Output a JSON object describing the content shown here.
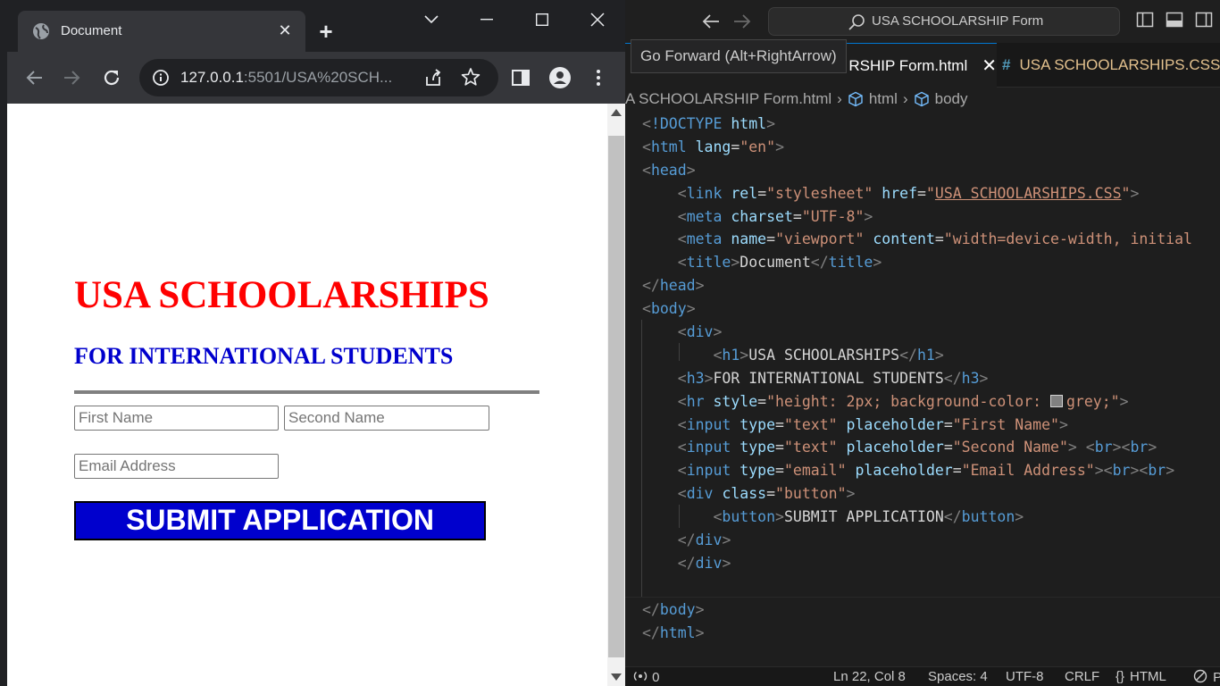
{
  "browser": {
    "tab": {
      "title": "Document",
      "close": "✕"
    },
    "new_tab": "+",
    "url_host": "127.0.0.1",
    "url_rest": ":5501/USA%20SCH...",
    "window_controls": {
      "list": "⌄",
      "minimize": "—",
      "maximize": "☐",
      "close": "✕"
    }
  },
  "page": {
    "heading": "USA SCHOOLARSHIPS",
    "subheading": "FOR INTERNATIONAL STUDENTS",
    "first_name_placeholder": "First Name",
    "second_name_placeholder": "Second Name",
    "email_placeholder": "Email Address",
    "submit_label": "SUBMIT APPLICATION",
    "colors": {
      "heading": "#ff0000",
      "subheading": "#0000cd",
      "button": "#0000cd",
      "rule": "#808080"
    }
  },
  "vscode": {
    "search_text": "USA SCHOOLARSHIP Form",
    "tooltip": "Go Forward (Alt+RightArrow)",
    "tabs": [
      {
        "label": "RSHIP Form.html",
        "close": "✕"
      },
      {
        "label": "USA SCHOOLARSHIPS.CSS",
        "icon": "#"
      }
    ],
    "breadcrumb": [
      "A SCHOOLARSHIP Form.html",
      "html",
      "body"
    ],
    "status": {
      "problems": "0",
      "position": "Ln 22, Col 8",
      "spaces": "Spaces: 4",
      "encoding": "UTF-8",
      "eol": "CRLF",
      "language": "HTML",
      "extra": "P"
    },
    "code": [
      {
        "indent": 0,
        "tokens": [
          [
            "punct",
            "<"
          ],
          [
            "tag",
            "!DOCTYPE"
          ],
          [
            "text",
            " "
          ],
          [
            "attr",
            "html"
          ],
          [
            "punct",
            ">"
          ]
        ]
      },
      {
        "indent": 0,
        "tokens": [
          [
            "punct",
            "<"
          ],
          [
            "tag",
            "html"
          ],
          [
            "text",
            " "
          ],
          [
            "attr",
            "lang"
          ],
          [
            "text",
            "="
          ],
          [
            "str",
            "\"en\""
          ],
          [
            "punct",
            ">"
          ]
        ]
      },
      {
        "indent": 0,
        "tokens": [
          [
            "punct",
            "<"
          ],
          [
            "tag",
            "head"
          ],
          [
            "punct",
            ">"
          ]
        ]
      },
      {
        "indent": 1,
        "tokens": [
          [
            "punct",
            "<"
          ],
          [
            "tag",
            "link"
          ],
          [
            "text",
            " "
          ],
          [
            "attr",
            "rel"
          ],
          [
            "text",
            "="
          ],
          [
            "str",
            "\"stylesheet\""
          ],
          [
            "text",
            " "
          ],
          [
            "attr",
            "href"
          ],
          [
            "text",
            "="
          ],
          [
            "str",
            "\""
          ],
          [
            "link",
            "USA SCHOOLARSHIPS.CSS"
          ],
          [
            "str",
            "\""
          ],
          [
            "punct",
            ">"
          ]
        ]
      },
      {
        "indent": 1,
        "tokens": [
          [
            "punct",
            "<"
          ],
          [
            "tag",
            "meta"
          ],
          [
            "text",
            " "
          ],
          [
            "attr",
            "charset"
          ],
          [
            "text",
            "="
          ],
          [
            "str",
            "\"UTF-8\""
          ],
          [
            "punct",
            ">"
          ]
        ]
      },
      {
        "indent": 1,
        "tokens": [
          [
            "punct",
            "<"
          ],
          [
            "tag",
            "meta"
          ],
          [
            "text",
            " "
          ],
          [
            "attr",
            "name"
          ],
          [
            "text",
            "="
          ],
          [
            "str",
            "\"viewport\""
          ],
          [
            "text",
            " "
          ],
          [
            "attr",
            "content"
          ],
          [
            "text",
            "="
          ],
          [
            "str",
            "\"width=device-width, initial"
          ]
        ]
      },
      {
        "indent": 1,
        "tokens": [
          [
            "punct",
            "<"
          ],
          [
            "tag",
            "title"
          ],
          [
            "punct",
            ">"
          ],
          [
            "text",
            "Document"
          ],
          [
            "punct",
            "</"
          ],
          [
            "tag",
            "title"
          ],
          [
            "punct",
            ">"
          ]
        ]
      },
      {
        "indent": 0,
        "tokens": [
          [
            "punct",
            "</"
          ],
          [
            "tag",
            "head"
          ],
          [
            "punct",
            ">"
          ]
        ]
      },
      {
        "indent": 0,
        "tokens": [
          [
            "punct",
            "<"
          ],
          [
            "tag",
            "body"
          ],
          [
            "punct",
            ">"
          ]
        ]
      },
      {
        "indent": 1,
        "tokens": [
          [
            "punct",
            "<"
          ],
          [
            "tag",
            "div"
          ],
          [
            "punct",
            ">"
          ]
        ]
      },
      {
        "indent": 2,
        "tokens": [
          [
            "punct",
            "<"
          ],
          [
            "tag",
            "h1"
          ],
          [
            "punct",
            ">"
          ],
          [
            "text",
            "USA SCHOOLARSHIPS"
          ],
          [
            "punct",
            "</"
          ],
          [
            "tag",
            "h1"
          ],
          [
            "punct",
            ">"
          ]
        ]
      },
      {
        "indent": 1,
        "tokens": [
          [
            "punct",
            "<"
          ],
          [
            "tag",
            "h3"
          ],
          [
            "punct",
            ">"
          ],
          [
            "text",
            "FOR INTERNATIONAL STUDENTS"
          ],
          [
            "punct",
            "</"
          ],
          [
            "tag",
            "h3"
          ],
          [
            "punct",
            ">"
          ]
        ]
      },
      {
        "indent": 1,
        "tokens": [
          [
            "punct",
            "<"
          ],
          [
            "tag",
            "hr"
          ],
          [
            "text",
            " "
          ],
          [
            "attr",
            "style"
          ],
          [
            "text",
            "="
          ],
          [
            "str",
            "\"height: 2px; background-color: "
          ],
          [
            "swatch",
            ""
          ],
          [
            "str",
            "grey;\""
          ],
          [
            "punct",
            ">"
          ]
        ]
      },
      {
        "indent": 1,
        "tokens": [
          [
            "punct",
            "<"
          ],
          [
            "tag",
            "input"
          ],
          [
            "text",
            " "
          ],
          [
            "attr",
            "type"
          ],
          [
            "text",
            "="
          ],
          [
            "str",
            "\"text\""
          ],
          [
            "text",
            " "
          ],
          [
            "attr",
            "placeholder"
          ],
          [
            "text",
            "="
          ],
          [
            "str",
            "\"First Name\""
          ],
          [
            "punct",
            ">"
          ]
        ]
      },
      {
        "indent": 1,
        "tokens": [
          [
            "punct",
            "<"
          ],
          [
            "tag",
            "input"
          ],
          [
            "text",
            " "
          ],
          [
            "attr",
            "type"
          ],
          [
            "text",
            "="
          ],
          [
            "str",
            "\"text\""
          ],
          [
            "text",
            " "
          ],
          [
            "attr",
            "placeholder"
          ],
          [
            "text",
            "="
          ],
          [
            "str",
            "\"Second Name\""
          ],
          [
            "punct",
            ">"
          ],
          [
            "text",
            " "
          ],
          [
            "punct",
            "<"
          ],
          [
            "tag",
            "br"
          ],
          [
            "punct",
            "><"
          ],
          [
            "tag",
            "br"
          ],
          [
            "punct",
            ">"
          ]
        ]
      },
      {
        "indent": 1,
        "tokens": [
          [
            "punct",
            "<"
          ],
          [
            "tag",
            "input"
          ],
          [
            "text",
            " "
          ],
          [
            "attr",
            "type"
          ],
          [
            "text",
            "="
          ],
          [
            "str",
            "\"email\""
          ],
          [
            "text",
            " "
          ],
          [
            "attr",
            "placeholder"
          ],
          [
            "text",
            "="
          ],
          [
            "str",
            "\"Email Address\""
          ],
          [
            "punct",
            "><"
          ],
          [
            "tag",
            "br"
          ],
          [
            "punct",
            "><"
          ],
          [
            "tag",
            "br"
          ],
          [
            "punct",
            ">"
          ]
        ]
      },
      {
        "indent": 1,
        "tokens": [
          [
            "punct",
            "<"
          ],
          [
            "tag",
            "div"
          ],
          [
            "text",
            " "
          ],
          [
            "attr",
            "class"
          ],
          [
            "text",
            "="
          ],
          [
            "str",
            "\"button\""
          ],
          [
            "punct",
            ">"
          ]
        ]
      },
      {
        "indent": 2,
        "tokens": [
          [
            "punct",
            "<"
          ],
          [
            "tag",
            "button"
          ],
          [
            "punct",
            ">"
          ],
          [
            "text",
            "SUBMIT APPLICATION"
          ],
          [
            "punct",
            "</"
          ],
          [
            "tag",
            "button"
          ],
          [
            "punct",
            ">"
          ]
        ]
      },
      {
        "indent": 1,
        "tokens": [
          [
            "punct",
            "</"
          ],
          [
            "tag",
            "div"
          ],
          [
            "punct",
            ">"
          ]
        ]
      },
      {
        "indent": 1,
        "tokens": [
          [
            "punct",
            "</"
          ],
          [
            "tag",
            "div"
          ],
          [
            "punct",
            ">"
          ]
        ]
      },
      {
        "indent": 0,
        "tokens": []
      },
      {
        "indent": 0,
        "tokens": [
          [
            "punct",
            "</"
          ],
          [
            "tag",
            "body"
          ],
          [
            "punct",
            ">"
          ]
        ]
      },
      {
        "indent": 0,
        "tokens": [
          [
            "punct",
            "</"
          ],
          [
            "tag",
            "html"
          ],
          [
            "punct",
            ">"
          ]
        ]
      }
    ]
  }
}
